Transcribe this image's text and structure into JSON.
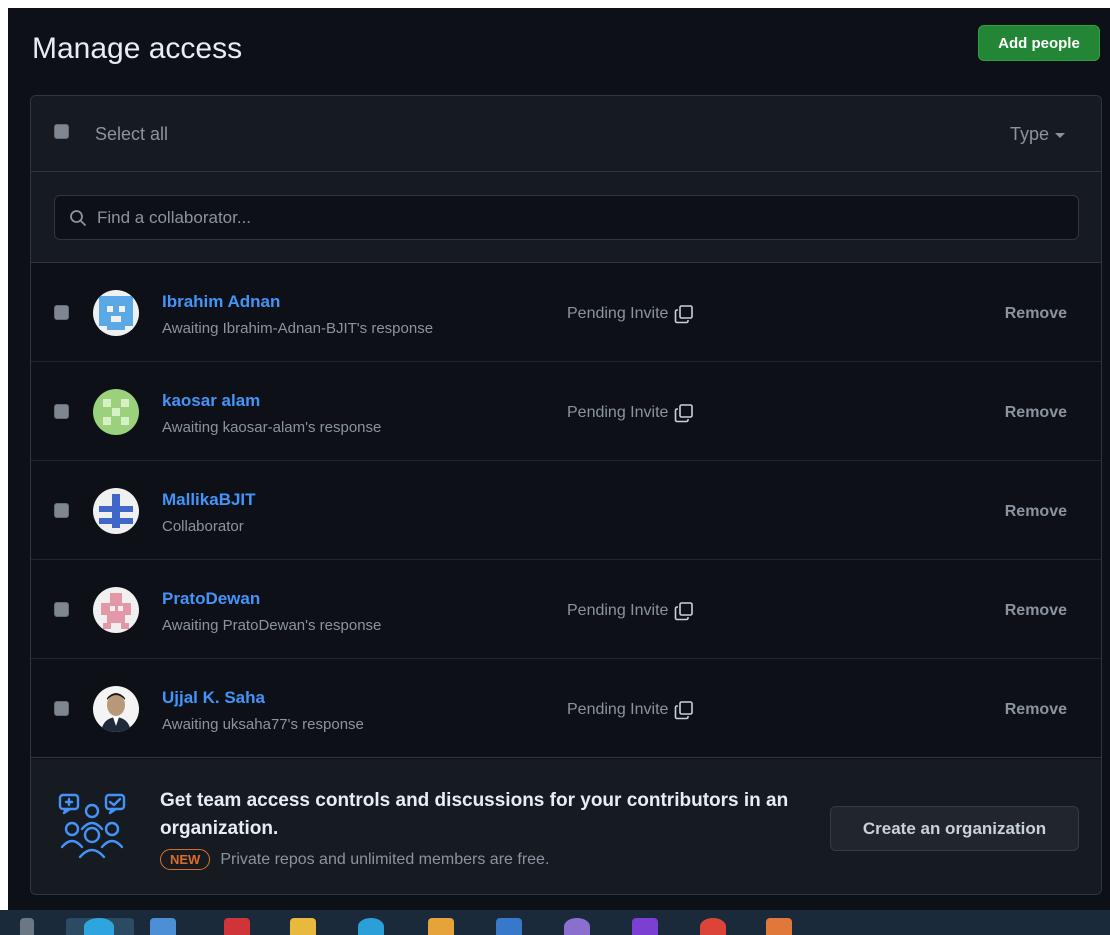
{
  "header": {
    "title": "Manage access",
    "add_button": "Add people"
  },
  "list_header": {
    "select_all_label": "Select all",
    "type_filter": "Type"
  },
  "search": {
    "placeholder": "Find a collaborator..."
  },
  "members": [
    {
      "name": "Ibrahim Adnan",
      "subtitle": "Awaiting Ibrahim-Adnan-BJIT's response",
      "status": "Pending Invite",
      "action": "Remove",
      "avatar_color": "#5aa9e6"
    },
    {
      "name": "kaosar alam",
      "subtitle": "Awaiting kaosar-alam's response",
      "status": "Pending Invite",
      "action": "Remove",
      "avatar_color": "#9bd17c"
    },
    {
      "name": "MallikaBJIT",
      "subtitle": "Collaborator",
      "status": "",
      "action": "Remove",
      "avatar_color": "#3e67c9"
    },
    {
      "name": "PratoDewan",
      "subtitle": "Awaiting PratoDewan's response",
      "status": "Pending Invite",
      "action": "Remove",
      "avatar_color": "#e398a8"
    },
    {
      "name": "Ujjal K. Saha",
      "subtitle": "Awaiting uksaha77's response",
      "status": "Pending Invite",
      "action": "Remove",
      "avatar_color": "#b89878"
    }
  ],
  "footer": {
    "headline": "Get team access controls and discussions for your contributors in an organization.",
    "badge": "NEW",
    "subtext": "Private repos and unlimited members are free.",
    "button": "Create an organization"
  },
  "colors": {
    "background": "#0d1117",
    "accent_green": "#238636",
    "link_blue": "#4493f8",
    "new_badge": "#db6d28"
  }
}
